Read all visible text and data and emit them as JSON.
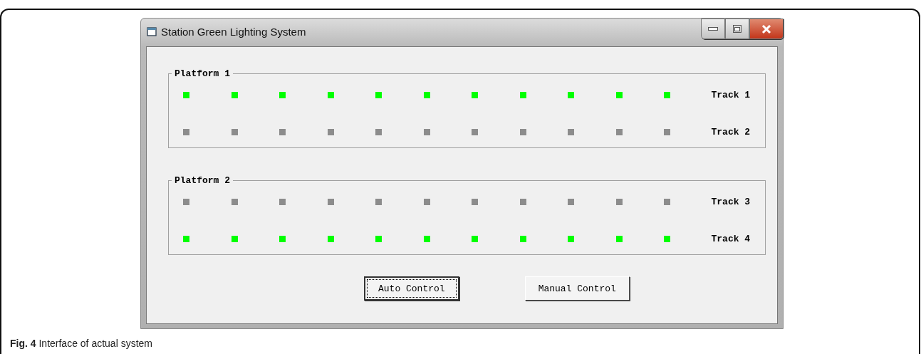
{
  "window": {
    "title": "Station Green Lighting System"
  },
  "platforms": [
    {
      "title": "Platform 1",
      "tracks": [
        {
          "label": "Track 1",
          "lamps": [
            true,
            true,
            true,
            true,
            true,
            true,
            true,
            true,
            true,
            true,
            true
          ]
        },
        {
          "label": "Track 2",
          "lamps": [
            false,
            false,
            false,
            false,
            false,
            false,
            false,
            false,
            false,
            false,
            false
          ]
        }
      ]
    },
    {
      "title": "Platform 2",
      "tracks": [
        {
          "label": "Track 3",
          "lamps": [
            false,
            false,
            false,
            false,
            false,
            false,
            false,
            false,
            false,
            false,
            false
          ]
        },
        {
          "label": "Track 4",
          "lamps": [
            true,
            true,
            true,
            true,
            true,
            true,
            true,
            true,
            true,
            true,
            true
          ]
        }
      ]
    }
  ],
  "buttons": [
    {
      "label": "Auto Control",
      "focused": true
    },
    {
      "label": "Manual Control",
      "focused": false
    }
  ],
  "caption": "**Fig. 4** Interface of actual system"
}
